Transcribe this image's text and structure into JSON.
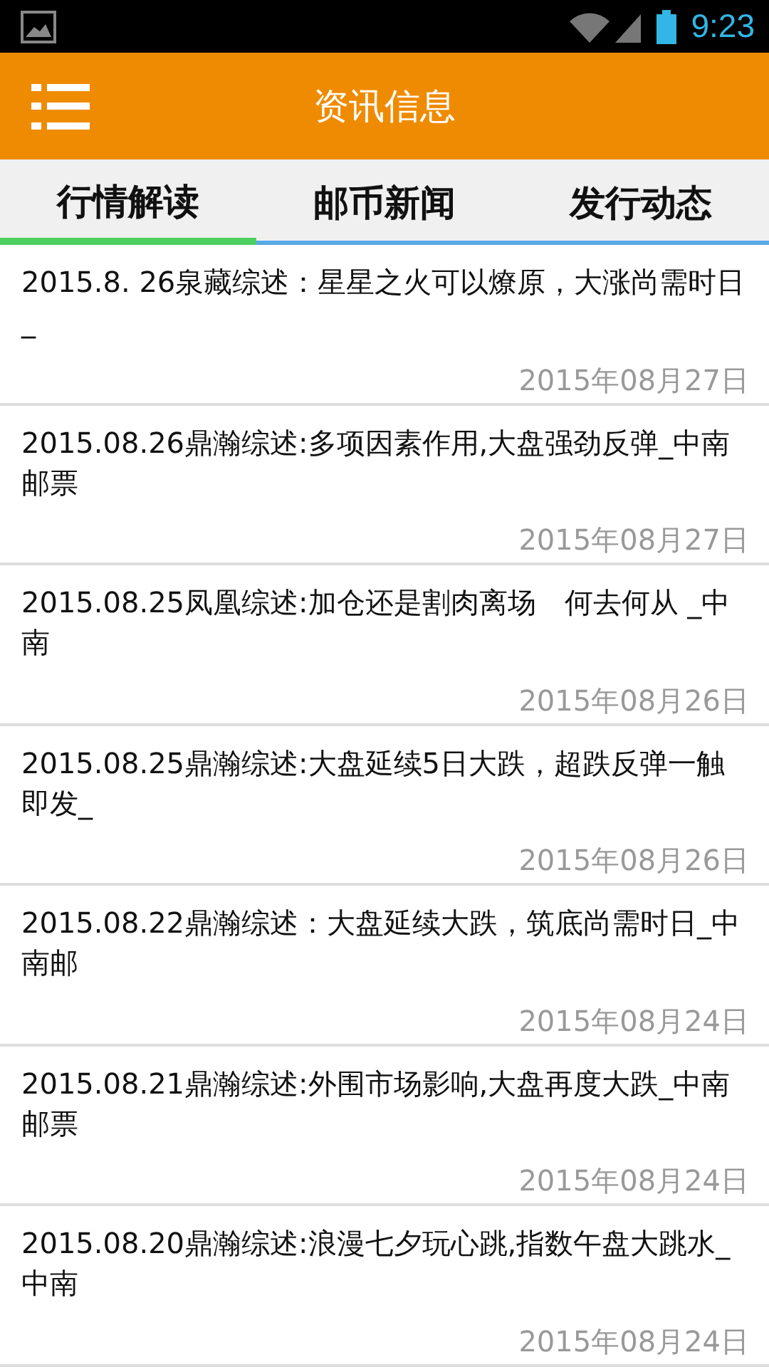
{
  "status_bar": {
    "time": "9:23"
  },
  "header": {
    "title": "资讯信息"
  },
  "tabs": [
    {
      "label": "行情解读",
      "selected": true
    },
    {
      "label": "邮币新闻",
      "selected": false
    },
    {
      "label": "发行动态",
      "selected": false
    }
  ],
  "news": [
    {
      "title": "2015.8. 26泉藏综述：星星之火可以燎原，大涨尚需时日_",
      "date": "2015年08月27日"
    },
    {
      "title": "2015.08.26鼎瀚综述:多项因素作用,大盘强劲反弹_中南邮票",
      "date": "2015年08月27日"
    },
    {
      "title": "2015.08.25凤凰综述:加仓还是割肉离场　何去何从 _中南",
      "date": "2015年08月26日"
    },
    {
      "title": "2015.08.25鼎瀚综述:大盘延续5日大跌，超跌反弹一触即发_",
      "date": "2015年08月26日"
    },
    {
      "title": "2015.08.22鼎瀚综述：大盘延续大跌，筑底尚需时日_中南邮",
      "date": "2015年08月24日"
    },
    {
      "title": "2015.08.21鼎瀚综述:外围市场影响,大盘再度大跌_中南邮票",
      "date": "2015年08月24日"
    },
    {
      "title": "2015.08.20鼎瀚综述:浪漫七夕玩心跳,指数午盘大跳水_中南",
      "date": "2015年08月24日"
    }
  ]
}
